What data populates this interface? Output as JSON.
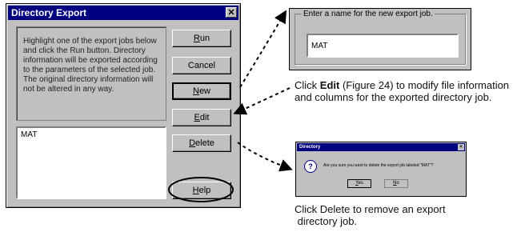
{
  "dialog": {
    "title": "Directory Export",
    "instructions": "Highlight one of the export jobs below and click the Run button. Directory information will be exported according to the parameters of the selected job. The original directory information will not be altered in any way.",
    "jobs": [
      "MAT"
    ],
    "buttons": {
      "run_underline": "R",
      "run_rest": "un",
      "cancel": "Cancel",
      "new_underline": "N",
      "new_rest": "ew",
      "edit_underline": "E",
      "edit_rest": "dit",
      "delete_underline": "D",
      "delete_rest": "elete",
      "help_underline": "H",
      "help_rest": "elp"
    }
  },
  "new_job": {
    "label": "Enter a name for the new export job.",
    "value": "MAT"
  },
  "captions": {
    "edit_pre": "Click ",
    "edit_bold": "Edit",
    "edit_post": " (Figure 24) to modify file information and columns for the exported directory job.",
    "delete_line1": "Click Delete to remove an export",
    "delete_line2": " directory job."
  },
  "confirm": {
    "title": "Directory",
    "message": "Are you sure you want to delete the export job labeled \"MAT\"?",
    "yes_underline": "Y",
    "yes_rest": "es",
    "no_underline": "N",
    "no_rest": "o"
  }
}
